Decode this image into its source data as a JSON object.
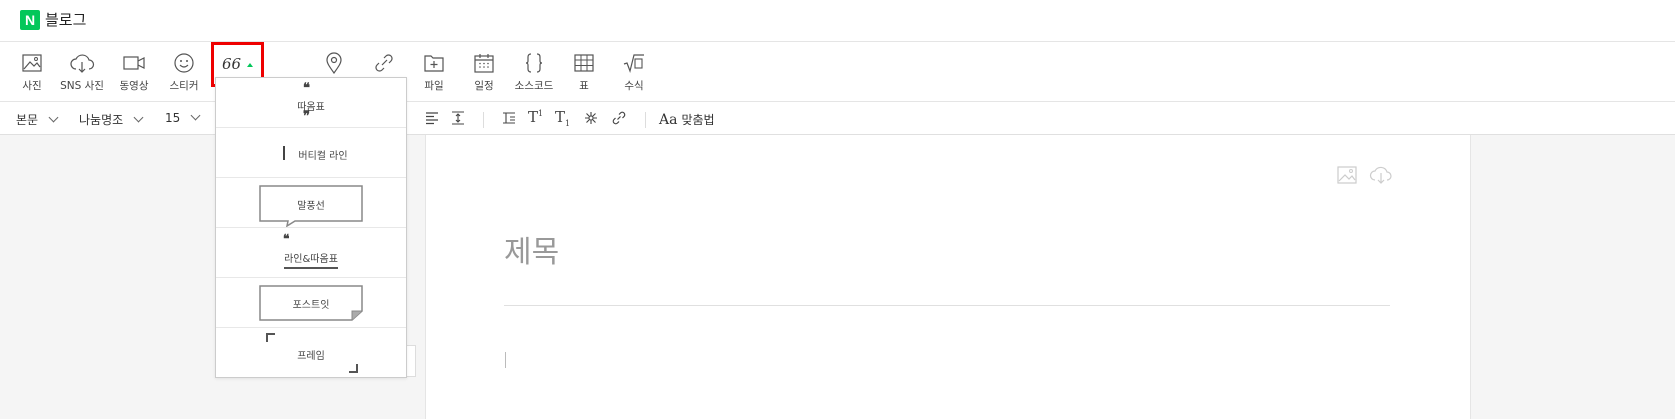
{
  "app": {
    "logo_letter": "N",
    "title": "블로그"
  },
  "toolbar": {
    "items": [
      {
        "label": "사진",
        "icon": "image-icon"
      },
      {
        "label": "SNS 사진",
        "icon": "cloud-download-icon"
      },
      {
        "label": "동영상",
        "icon": "video-icon"
      },
      {
        "label": "스티커",
        "icon": "smile-icon"
      },
      {
        "label": "파일",
        "icon": "file-plus-icon"
      },
      {
        "label": "일정",
        "icon": "calendar-icon"
      },
      {
        "label": "소스코드",
        "icon": "braces-icon"
      },
      {
        "label": "표",
        "icon": "table-icon"
      },
      {
        "label": "수식",
        "icon": "sqrt-icon"
      }
    ],
    "quote_symbol": "66"
  },
  "formatbar": {
    "paragraph_style": "본문",
    "font": "나눔명조",
    "font_size": "15",
    "spellcheck": "맞춤법"
  },
  "editor": {
    "title_placeholder": "제목"
  },
  "quote_menu": {
    "items": [
      {
        "label": "따옴표"
      },
      {
        "label": "버티컬 라인"
      },
      {
        "label": "말풍선"
      },
      {
        "label": "라인&따옴표"
      },
      {
        "label": "포스트잇"
      },
      {
        "label": "프레임"
      }
    ]
  },
  "colors": {
    "brand": "#03c75a",
    "highlight": "#e00000"
  }
}
